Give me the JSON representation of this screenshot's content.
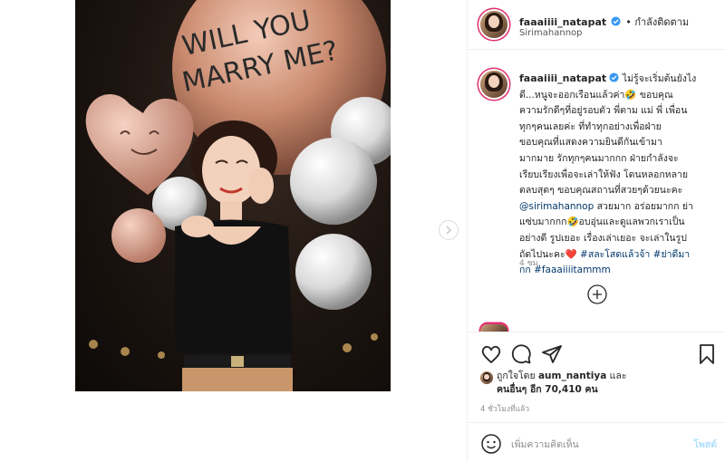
{
  "header": {
    "username": "faaaiiii_natapat",
    "follow_label": "• กำลังติดตาม",
    "location": "Sirimahannop"
  },
  "photo": {
    "balloon_text_1": "WILL YOU",
    "balloon_text_2": "MARRY ME?"
  },
  "caption": {
    "username": "faaaiiii_natapat",
    "line1": "ไม่รู้จะเริ่มต้นยังไง",
    "line2": "ดี...หนูจะออกเรือนแล้วค่า🤣 ขอบคุณ",
    "line3": "ความรักดีๆที่อยู่รอบตัว พี่ตาม แม่ พี่ เพื่อน",
    "line4": "ทุกๆคนเลยค่ะ ที่ทำทุกอย่างเพื่อฝ่าย",
    "line5": "ขอบคุณที่แสดงความยินดีกันเข้ามา",
    "line6": "มากมาย รักทุกๆคนมากกก ฝ่ายกำลังจะ",
    "line7": "เรียบเรียงเพื่อจะเล่าให้ฟัง โดนหลอกหลาย",
    "line8": "ตลบสุดๆ ขอบคุณสถานที่สวยๆด้วยนะคะ",
    "mention": "@sirimahannop",
    "line9_rest": " สวยมาก อร่อยมากก ย่า",
    "line10": "แซ่บมากกก🤣อบอุ่นและดูแลพวกเราเป็น",
    "line11": "อย่างดี รูปเยอะ เรื่องเล่าเยอะ จะเล่าในรูป",
    "line12_start": "ถัดไปนะคะ❤️ ",
    "tag1": "#สละโสดแล้วจ้า",
    "tag2": "#ย่าดีมา",
    "line13_tag_cont": "กก",
    "tag3": "#faaaiiiitammm",
    "time": "4 ชม."
  },
  "likes": {
    "liked_by_prefix": "ถูกใจโดย",
    "liked_by_user": "aum_nantiya",
    "and": "และ",
    "others_prefix": "คนอื่นๆ",
    "others_count": "อีก 70,410 คน"
  },
  "post_time": "4 ชั่วโมงที่แล้ว",
  "comment": {
    "placeholder": "เพิ่มความคิดเห็น",
    "post_label": "โพสต์"
  },
  "colors": {
    "link": "#00376b",
    "verified": "#3897f0",
    "post_disabled": "#b2dffc"
  }
}
